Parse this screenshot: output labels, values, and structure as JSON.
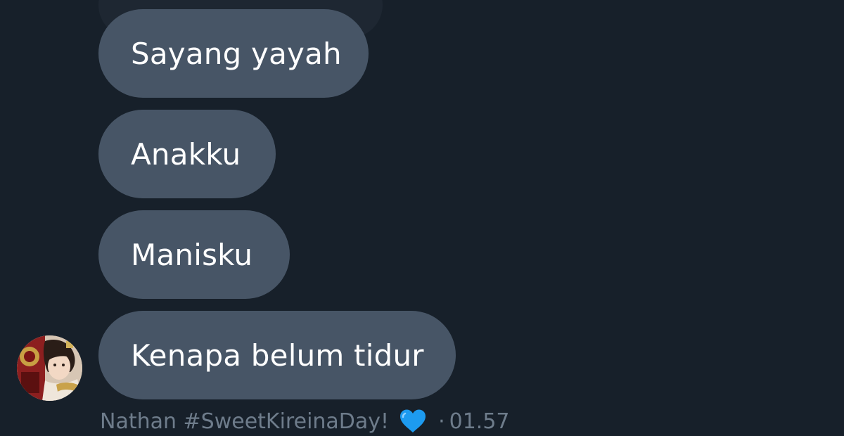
{
  "messages": [
    {
      "text": "Sayang yayah"
    },
    {
      "text": "Anakku"
    },
    {
      "text": "Manisku"
    },
    {
      "text": "Kenapa belum tidur"
    }
  ],
  "sender": {
    "display_name": "Nathan #SweetKireinaDay!",
    "badge_icon": "blue-heart-icon",
    "avatar": "profile-photo"
  },
  "timestamp": "01.57",
  "separator": "·",
  "colors": {
    "background": "#17202a",
    "bubble": "#475566",
    "bubble_text": "#ffffff",
    "meta_text": "#6e7c8b",
    "heart": "#1d9bf0"
  }
}
